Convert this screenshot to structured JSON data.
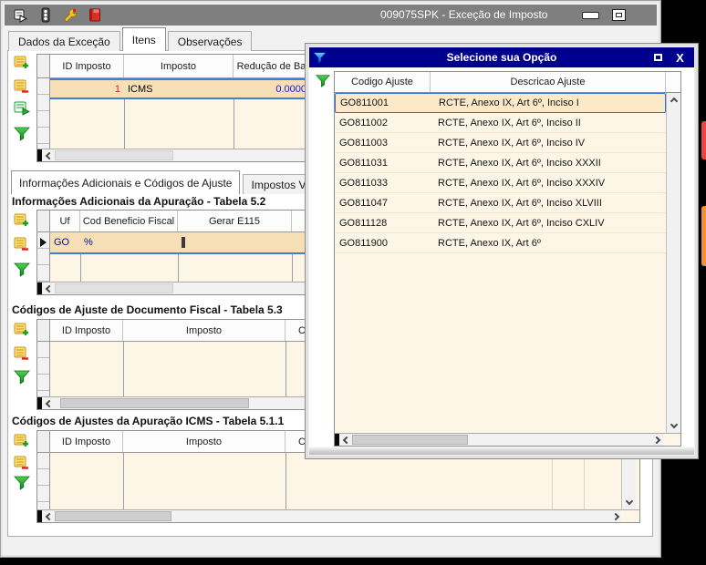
{
  "window": {
    "title": "009075SPK - Exceção de Imposto",
    "tabs": {
      "dados": "Dados da Exceção",
      "itens": "Itens",
      "observacoes": "Observações"
    },
    "titlebar_icons": [
      "export-form-icon",
      "traffic-light-icon",
      "wrench-icon",
      "book-icon"
    ]
  },
  "grid1": {
    "headers": [
      "ID Imposto",
      "Imposto",
      "Redução de Ba"
    ],
    "row": {
      "id": "1",
      "imposto": "ICMS",
      "reducao": "0.0000"
    }
  },
  "inner_tabs": {
    "tab1": "Informações Adicionais e Códigos de Ajuste",
    "tab2": "Impostos Vinculad"
  },
  "sections": {
    "s52": {
      "title": "Informações Adicionais da Apuração - Tabela 5.2",
      "headers": [
        "Uf",
        "Cod Beneficio Fiscal",
        "Gerar E115"
      ],
      "row": {
        "uf": "GO",
        "cod": "%",
        "gerar_e115_checked": false
      }
    },
    "s53": {
      "title": "Códigos de Ajuste de Documento Fiscal - Tabela 5.3",
      "headers": [
        "ID Imposto",
        "Imposto",
        "C"
      ]
    },
    "s511": {
      "title": "Códigos de Ajustes da Apuração ICMS - Tabela 5.1.1",
      "headers": [
        "ID Imposto",
        "Imposto",
        "C"
      ]
    }
  },
  "dialog": {
    "title": "Selecione sua Opção",
    "headers": {
      "code": "Codigo Ajuste",
      "desc": "Descricao Ajuste"
    },
    "selected_index": 0,
    "rows": [
      {
        "code": "GO811001",
        "desc": "RCTE, Anexo IX, Art 6º, Inciso I"
      },
      {
        "code": "GO811002",
        "desc": "RCTE, Anexo IX, Art 6º, Inciso II"
      },
      {
        "code": "GO811003",
        "desc": "RCTE, Anexo IX, Art 6º, Inciso IV"
      },
      {
        "code": "GO811031",
        "desc": "RCTE, Anexo IX, Art 6º, Inciso XXXII"
      },
      {
        "code": "GO811033",
        "desc": "RCTE, Anexo IX, Art 6º, Inciso XXXIV"
      },
      {
        "code": "GO811047",
        "desc": "RCTE, Anexo IX, Art 6º, Inciso XLVIII"
      },
      {
        "code": "GO811128",
        "desc": "RCTE, Anexo IX, Art 6º, Inciso CXLIV"
      },
      {
        "code": "GO811900",
        "desc": "RCTE, Anexo IX, Art 6º"
      }
    ]
  },
  "colors": {
    "desktop_bg": "#000000",
    "main_titlebar": "#7F7F7F",
    "dialog_titlebar": "#00008F",
    "grid_bg": "#FDF6E7",
    "selected_row": "#F6DFB5",
    "dialog_selected_row": "#FBE9C8",
    "selection_border": "#3F7ED6",
    "value_red": "#E02020",
    "value_blue": "#1414E6",
    "value_navy": "#00128F"
  }
}
